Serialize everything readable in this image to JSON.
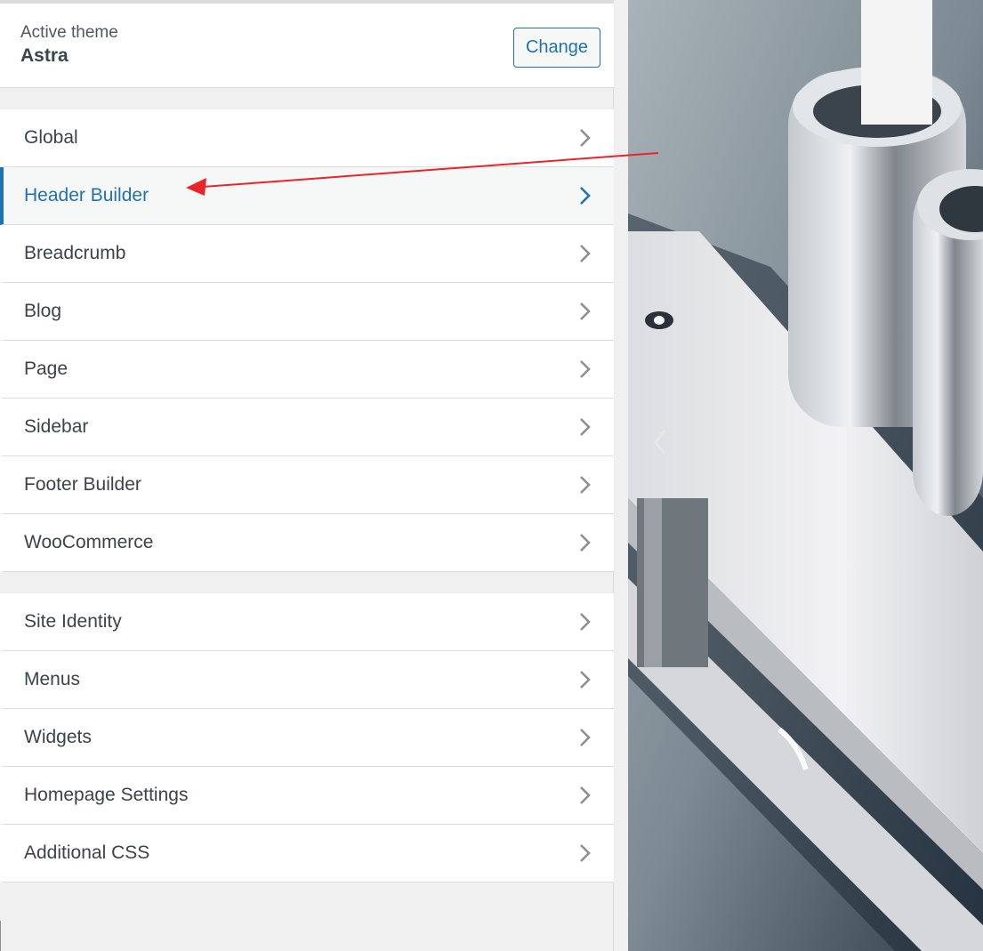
{
  "theme": {
    "label": "Active theme",
    "name": "Astra",
    "change_label": "Change"
  },
  "sections_primary": [
    {
      "label": "Global",
      "active": false
    },
    {
      "label": "Header Builder",
      "active": true
    },
    {
      "label": "Breadcrumb",
      "active": false
    },
    {
      "label": "Blog",
      "active": false
    },
    {
      "label": "Page",
      "active": false
    },
    {
      "label": "Sidebar",
      "active": false
    },
    {
      "label": "Footer Builder",
      "active": false
    },
    {
      "label": "WooCommerce",
      "active": false
    }
  ],
  "sections_secondary": [
    {
      "label": "Site Identity"
    },
    {
      "label": "Menus"
    },
    {
      "label": "Widgets"
    },
    {
      "label": "Homepage Settings"
    },
    {
      "label": "Additional CSS"
    }
  ],
  "colors": {
    "accent": "#2271b1",
    "annotation_arrow": "#e8262a"
  },
  "icons": {
    "item_chevron": "chevron-right-icon",
    "preview_prev": "chevron-left-icon"
  }
}
